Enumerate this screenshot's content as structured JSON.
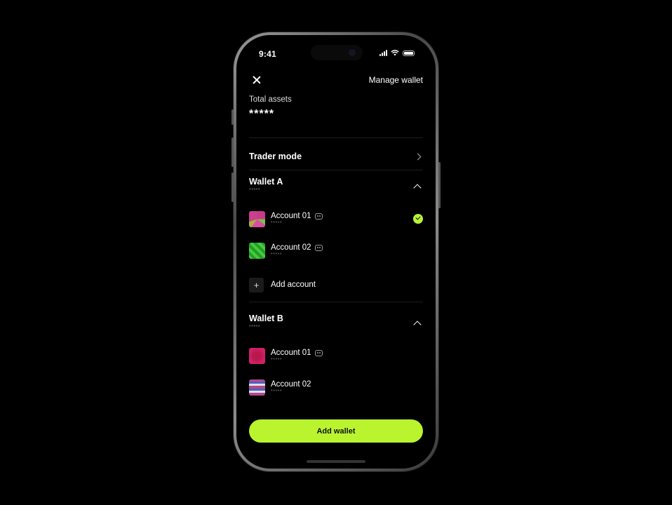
{
  "status_bar": {
    "time": "9:41"
  },
  "header": {
    "manage_label": "Manage wallet"
  },
  "total_assets": {
    "label": "Total assets",
    "value": "*****"
  },
  "trader_mode": {
    "label": "Trader mode"
  },
  "wallets": [
    {
      "name": "Wallet A",
      "balance": "*****",
      "accounts": [
        {
          "name": "Account 01",
          "balance": "*****",
          "selected": true
        },
        {
          "name": "Account 02",
          "balance": "*****"
        }
      ],
      "add_account_label": "Add account"
    },
    {
      "name": "Wallet B",
      "balance": "*****",
      "accounts": [
        {
          "name": "Account 01",
          "balance": "*****"
        },
        {
          "name": "Account 02",
          "balance": "*****"
        }
      ]
    }
  ],
  "add_wallet_label": "Add wallet",
  "colors": {
    "accent": "#b9f42f",
    "background": "#000000"
  }
}
